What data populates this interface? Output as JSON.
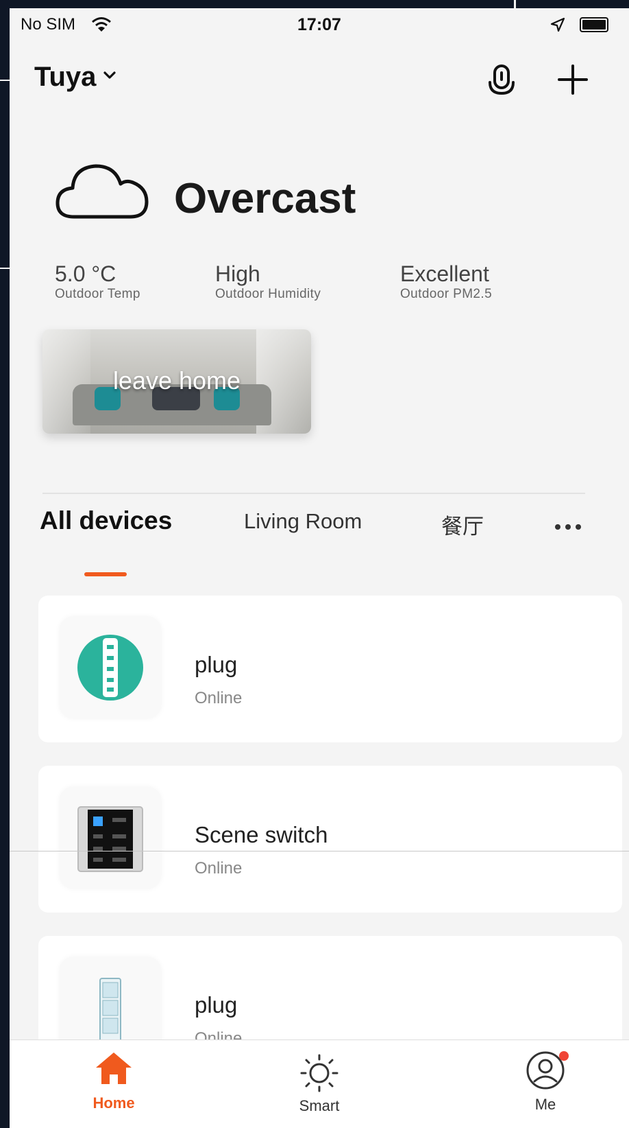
{
  "status_bar": {
    "carrier": "No SIM",
    "time": "17:07"
  },
  "header": {
    "home_name": "Tuya",
    "icons": [
      "chevron-down-icon",
      "microphone-icon",
      "plus-icon"
    ]
  },
  "weather": {
    "condition": "Overcast",
    "icon": "cloud-icon",
    "stats": [
      {
        "value": "5.0 °C",
        "label": "Outdoor Temp"
      },
      {
        "value": "High",
        "label": "Outdoor Humidity"
      },
      {
        "value": "Excellent",
        "label": "Outdoor PM2.5"
      }
    ]
  },
  "scene": {
    "label": "leave home"
  },
  "rooms": {
    "tabs": [
      "All devices",
      "Living Room",
      "餐厅"
    ],
    "active_index": 0
  },
  "devices": [
    {
      "name": "plug",
      "status": "Online",
      "icon": "power-strip-icon"
    },
    {
      "name": "Scene switch",
      "status": "Online",
      "icon": "scene-switch-icon"
    },
    {
      "name": "plug",
      "status": "Online",
      "icon": "socket-panel-icon"
    }
  ],
  "bottom_nav": {
    "items": [
      {
        "label": "Home",
        "icon": "home-icon"
      },
      {
        "label": "Smart",
        "icon": "sun-icon"
      },
      {
        "label": "Me",
        "icon": "profile-icon"
      }
    ],
    "active_index": 0
  },
  "colors": {
    "accent": "#f05a1e",
    "plug_icon": "#2bb39c",
    "badge": "#f04436"
  }
}
